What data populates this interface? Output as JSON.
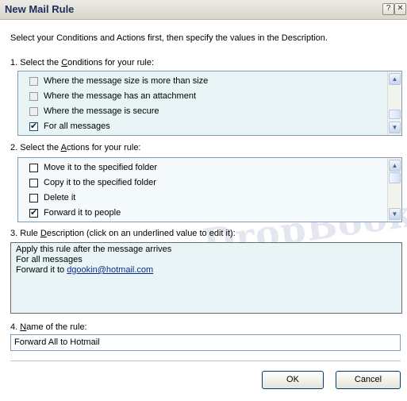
{
  "window": {
    "title": "New Mail Rule",
    "help_glyph": "?",
    "close_glyph": "✕"
  },
  "intro": "Select your Conditions and Actions first, then specify the values in the Description.",
  "conditions": {
    "label_pre": "1. Select the ",
    "label_u": "C",
    "label_post": "onditions for your rule:",
    "items": [
      {
        "label": "Where the message size is more than size",
        "checked": false
      },
      {
        "label": "Where the message has an attachment",
        "checked": false
      },
      {
        "label": "Where the message is secure",
        "checked": false
      },
      {
        "label": "For all messages",
        "checked": true
      }
    ]
  },
  "actions": {
    "label_pre": "2. Select the ",
    "label_u": "A",
    "label_post": "ctions for your rule:",
    "items": [
      {
        "label": "Move it to the specified folder",
        "checked": false
      },
      {
        "label": "Copy it to the specified folder",
        "checked": false
      },
      {
        "label": "Delete it",
        "checked": false
      },
      {
        "label": "Forward it to people",
        "checked": true
      }
    ]
  },
  "description": {
    "label_pre": "3. Rule ",
    "label_u": "D",
    "label_post": "escription (click on an underlined value to edit it):",
    "lines": [
      "Apply this rule after the message arrives",
      "For all messages"
    ],
    "forward_prefix": "Forward it to ",
    "forward_link": "dgookin@hotmail.com"
  },
  "name": {
    "label_pre": "4. ",
    "label_u": "N",
    "label_post": "ame of the rule:",
    "value": "Forward All to Hotmail"
  },
  "buttons": {
    "ok": "OK",
    "cancel": "Cancel"
  },
  "watermark": "DropBook",
  "colors": {
    "title_text": "#1f2c5c",
    "list_bg": "#e9f4f7",
    "link": "#0a2b8f"
  }
}
